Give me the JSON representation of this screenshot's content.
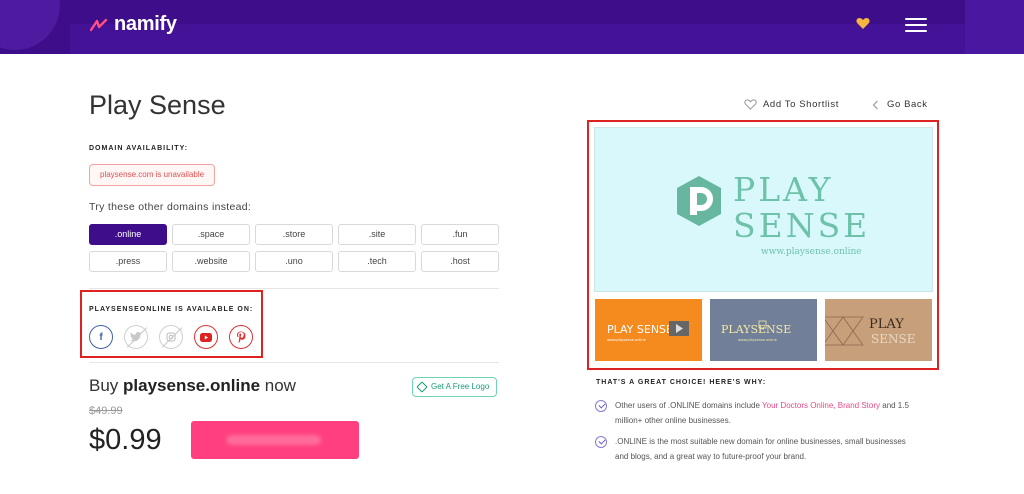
{
  "header": {
    "brand": "namify"
  },
  "left": {
    "title": "Play Sense",
    "availability_label": "DOMAIN AVAILABILITY:",
    "unavailable_text": "playsense.com is unavailable",
    "try_text": "Try these other domains instead:",
    "tlds": [
      ".online",
      ".space",
      ".store",
      ".site",
      ".fun",
      ".press",
      ".website",
      ".uno",
      ".tech",
      ".host"
    ],
    "selected_tld": ".online",
    "social_label": "PLAYSENSEONLINE IS AVAILABLE ON:",
    "social_icons": [
      "facebook-icon",
      "twitter-icon",
      "instagram-icon",
      "youtube-icon",
      "pinterest-icon"
    ],
    "buy_prefix": "Buy",
    "buy_domain": "playsense.online",
    "buy_suffix": "now",
    "logo_button": "Get A Free Logo",
    "old_price": "$49.99",
    "price": "$0.99"
  },
  "right": {
    "shortlist": "Add To Shortlist",
    "goback": "Go Back",
    "preview_word1": "PLAY",
    "preview_word2": "SENSE",
    "preview_url": "www.playsense.online",
    "thumb1_text": "PLAY SENSE",
    "thumb2_text": "PLAYSENSE",
    "thumb3_word1": "PLAY",
    "thumb3_word2": "SENSE",
    "great_choice": "THAT'S A GREAT CHOICE! HERE'S WHY:",
    "bullet1_pre": "Other users of .ONLINE domains include ",
    "bullet1_links": "Your Doctors Online, Brand Story",
    "bullet1_post": " and 1.5 million+ other online businesses.",
    "bullet2": ".ONLINE is the most suitable new domain for online businesses, small businesses and blogs, and a great way to future-proof your brand."
  },
  "colors": {
    "header": "#3e0d8a",
    "accent_pink": "#ff3f7f",
    "teal": "#6fc2aa"
  }
}
